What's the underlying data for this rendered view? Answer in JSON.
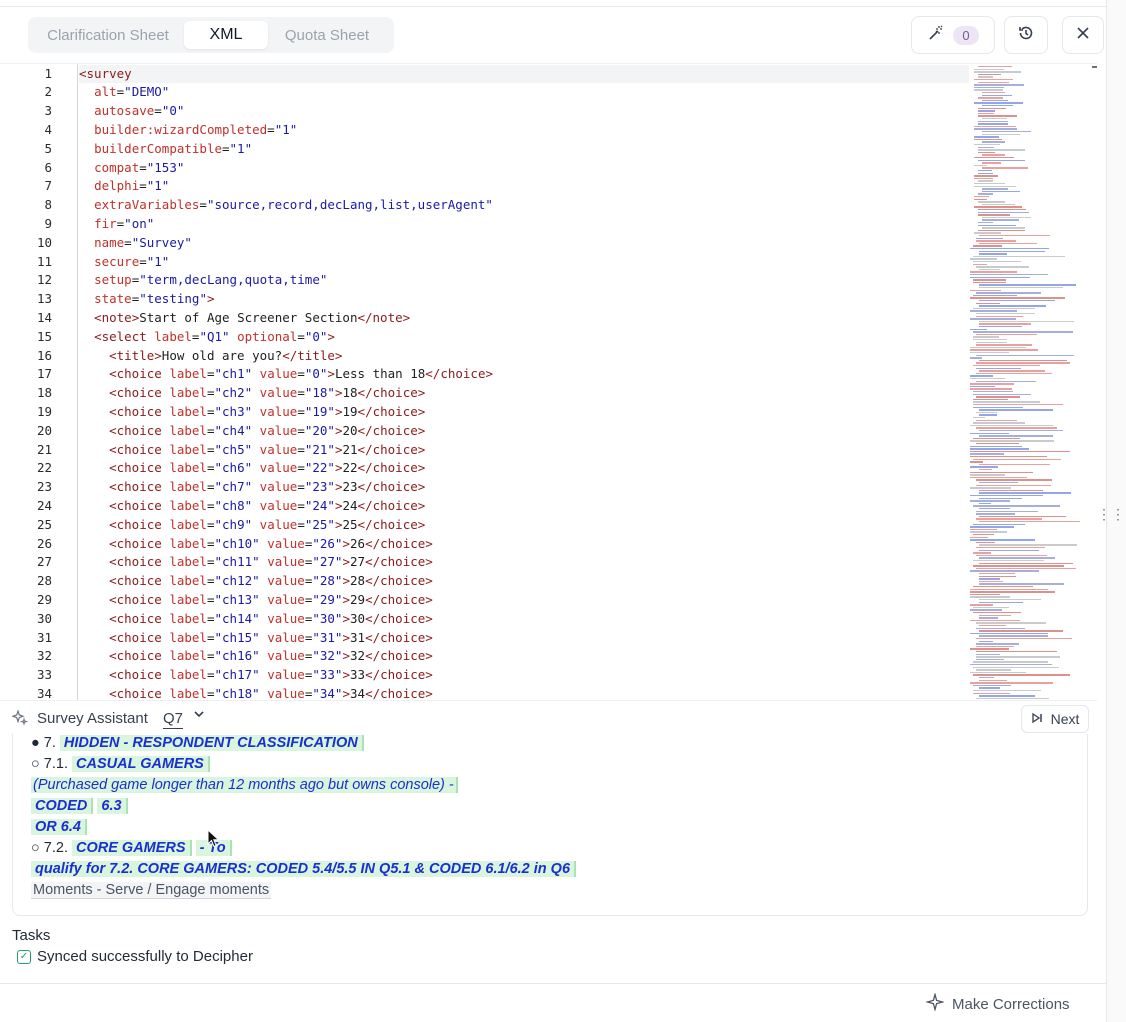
{
  "header": {
    "tabs": [
      {
        "label": "Clarification Sheet",
        "active": false
      },
      {
        "label": "XML",
        "active": true
      },
      {
        "label": "Quota Sheet",
        "active": false
      }
    ],
    "suggestion_count": "0",
    "icons": [
      "magic-wand-icon",
      "history-icon",
      "close-icon"
    ]
  },
  "editor": {
    "language": "xml",
    "line_numbers": [
      "1",
      "2",
      "3",
      "4",
      "5",
      "6",
      "7",
      "8",
      "9",
      "10",
      "11",
      "12",
      "13",
      "14",
      "15",
      "16",
      "17",
      "18",
      "19",
      "20",
      "21",
      "22",
      "23",
      "24",
      "25",
      "26",
      "27",
      "28",
      "29",
      "30",
      "31",
      "32",
      "33",
      "34"
    ],
    "lines": [
      "<survey",
      "  alt=\"DEMO\"",
      "  autosave=\"0\"",
      "  builder:wizardCompleted=\"1\"",
      "  builderCompatible=\"1\"",
      "  compat=\"153\"",
      "  delphi=\"1\"",
      "  extraVariables=\"source,record,decLang,list,userAgent\"",
      "  fir=\"on\"",
      "  name=\"Survey\"",
      "  secure=\"1\"",
      "  setup=\"term,decLang,quota,time\"",
      "  state=\"testing\">",
      "  <note>Start of Age Screener Section</note>",
      "  <select label=\"Q1\" optional=\"0\">",
      "    <title>How old are you?</title>",
      "    <choice label=\"ch1\" value=\"0\">Less than 18</choice>",
      "    <choice label=\"ch2\" value=\"18\">18</choice>",
      "    <choice label=\"ch3\" value=\"19\">19</choice>",
      "    <choice label=\"ch4\" value=\"20\">20</choice>",
      "    <choice label=\"ch5\" value=\"21\">21</choice>",
      "    <choice label=\"ch6\" value=\"22\">22</choice>",
      "    <choice label=\"ch7\" value=\"23\">23</choice>",
      "    <choice label=\"ch8\" value=\"24\">24</choice>",
      "    <choice label=\"ch9\" value=\"25\">25</choice>",
      "    <choice label=\"ch10\" value=\"26\">26</choice>",
      "    <choice label=\"ch11\" value=\"27\">27</choice>",
      "    <choice label=\"ch12\" value=\"28\">28</choice>",
      "    <choice label=\"ch13\" value=\"29\">29</choice>",
      "    <choice label=\"ch14\" value=\"30\">30</choice>",
      "    <choice label=\"ch15\" value=\"31\">31</choice>",
      "    <choice label=\"ch16\" value=\"32\">32</choice>",
      "    <choice label=\"ch17\" value=\"33\">33</choice>",
      "    <choice label=\"ch18\" value=\"34\">34</choice>"
    ]
  },
  "assistant": {
    "title": "Survey Assistant",
    "question": "Q7",
    "next_label": "Next",
    "content": {
      "b1_marker": "● 7.",
      "b1_text": "HIDDEN - RESPONDENT CLASSIFICATION",
      "b2_marker": "○ 7.1.",
      "b2_text": "CASUAL GAMERS",
      "purchased": "(Purchased game longer than 12 months ago but owns console) -",
      "coded": "CODED",
      "coded_val": "6.3",
      "or_text": "OR 6.4",
      "b3_marker": "○ 7.2.",
      "b3_text": "CORE GAMERS",
      "b3_suffix": "- To",
      "qualify": "qualify for 7.2. CORE GAMERS: CODED 5.4/5.5 IN Q5.1 & CODED 6.1/6.2 in Q6",
      "moments": "Moments - Serve / Engage moments"
    }
  },
  "tasks": {
    "title": "Tasks",
    "items": [
      {
        "label": "Synced successfully to Decipher",
        "done": true
      }
    ]
  },
  "footer": {
    "make_corrections": "Make Corrections"
  },
  "colors": {
    "tag": "#8b1a1a",
    "attr": "#c0312a",
    "string": "#1a1aa6",
    "highlight": "#d9f5de",
    "highlight_text": "#1a2fd1",
    "badge_bg": "#ede4f4"
  }
}
